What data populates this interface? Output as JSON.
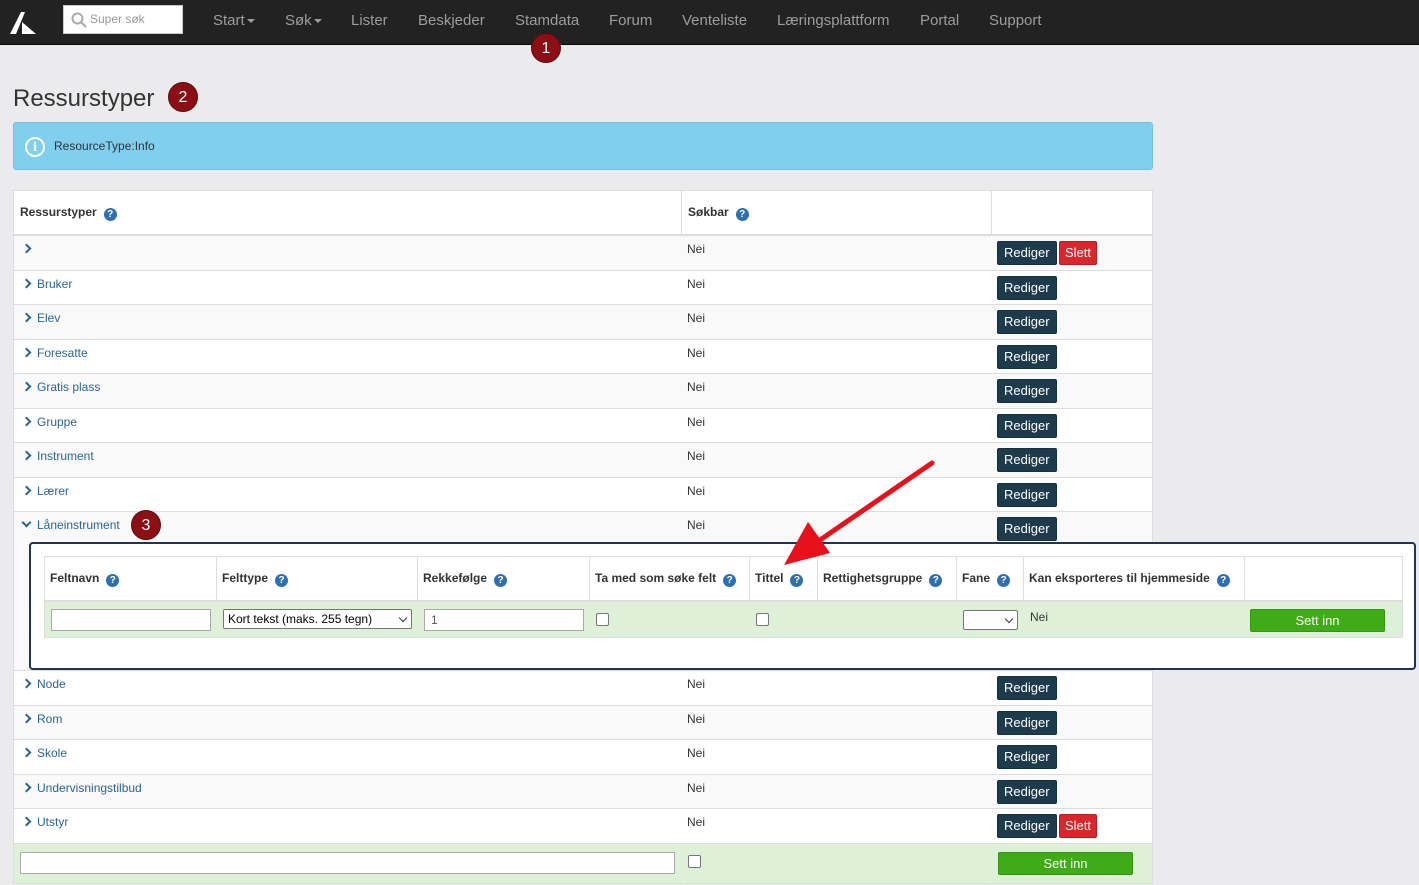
{
  "nav": {
    "search_placeholder": "Super søk",
    "items": [
      {
        "label": "Start",
        "dropdown": true
      },
      {
        "label": "Søk",
        "dropdown": true
      },
      {
        "label": "Lister"
      },
      {
        "label": "Beskjeder"
      },
      {
        "label": "Stamdata"
      },
      {
        "label": "Forum"
      },
      {
        "label": "Venteliste"
      },
      {
        "label": "Læringsplattform"
      },
      {
        "label": "Portal"
      },
      {
        "label": "Support"
      }
    ]
  },
  "markers": {
    "one": "1",
    "two": "2",
    "three": "3"
  },
  "page_title": "Ressurstyper",
  "alert_text": "ResourceType:Info",
  "table": {
    "col_name": "Ressurstyper",
    "col_searchable": "Søkbar",
    "help_glyph": "?",
    "edit_label": "Rediger",
    "delete_label": "Slett",
    "rows": [
      {
        "name": "",
        "searchable": "Nei",
        "deletable": true
      },
      {
        "name": "Bruker",
        "searchable": "Nei"
      },
      {
        "name": "Elev",
        "searchable": "Nei"
      },
      {
        "name": "Foresatte",
        "searchable": "Nei"
      },
      {
        "name": "Gratis plass",
        "searchable": "Nei"
      },
      {
        "name": "Gruppe",
        "searchable": "Nei"
      },
      {
        "name": "Instrument",
        "searchable": "Nei"
      },
      {
        "name": "Lærer",
        "searchable": "Nei"
      },
      {
        "name": "Låneinstrument",
        "searchable": "Nei",
        "expanded": true
      },
      {
        "name": "Node",
        "searchable": "Nei"
      },
      {
        "name": "Rom",
        "searchable": "Nei"
      },
      {
        "name": "Skole",
        "searchable": "Nei"
      },
      {
        "name": "Undervisningstilbud",
        "searchable": "Nei"
      },
      {
        "name": "Utstyr",
        "searchable": "Nei",
        "deletable": true
      }
    ],
    "insert_label": "Sett inn"
  },
  "subtable": {
    "headers": [
      "Feltnavn",
      "Felttype",
      "Rekkefølge",
      "Ta med som søke felt",
      "Tittel",
      "Rettighetsgruppe",
      "Fane",
      "Kan eksporteres til hjemmeside"
    ],
    "feltnavn_value": "",
    "felttype_value": "Kort tekst (maks. 255 tegn)",
    "rekkefolge_value": "1",
    "ta_med_checked": false,
    "tittel_checked": false,
    "fane_value": "",
    "export_value": "Nei",
    "insert_label": "Sett inn"
  },
  "colors": {
    "accent_dark": "#1d3b4c",
    "danger": "#d9272b",
    "success": "#3fab16",
    "marker": "#8b0f14",
    "annotation_arrow": "#e8101a"
  }
}
